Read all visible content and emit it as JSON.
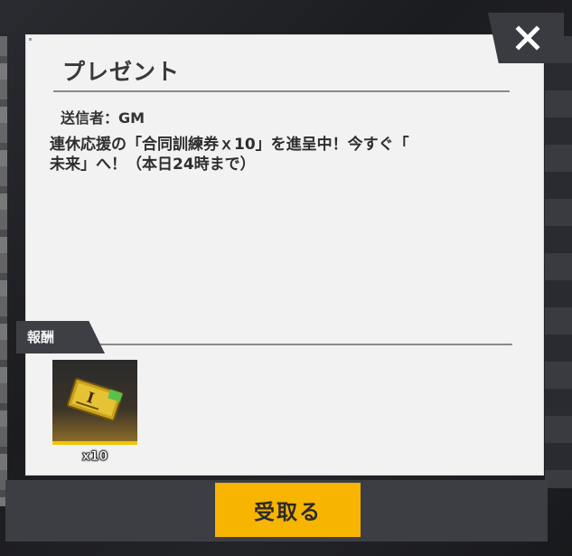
{
  "dialog": {
    "title": "プレゼント",
    "sender_label": "送信者：",
    "sender_name": "GM",
    "message_line1": "連休応援の「合同訓練券ｘ10」を進呈中！今すぐ「",
    "message_line2": "未来」へ！（本日24時まで）",
    "close_icon": "close-x-icon"
  },
  "reward": {
    "section_label": "報酬",
    "item": {
      "icon": "training-ticket-icon",
      "quantity": "x10",
      "accent_color": "#f2c400"
    }
  },
  "actions": {
    "receive_label": "受取る",
    "receive_color": "#f7b400"
  }
}
